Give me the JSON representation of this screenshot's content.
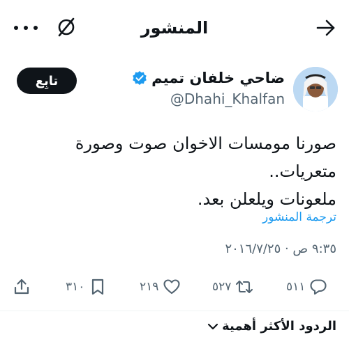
{
  "header": {
    "title": "المنشور",
    "more_icon": "more-horizontal-icon",
    "grok_icon": "grok-icon",
    "back_icon": "arrow-right-icon"
  },
  "author": {
    "name": "ضاحي خلفان تميم",
    "handle": "@Dhahi_Khalfan",
    "verified": true,
    "follow_label": "تابِع"
  },
  "tweet": {
    "line1": "صورنا مومسات الاخوان صوت وصورة متعريات..",
    "line2": "ملعونات ويلعلن بعد.",
    "translate_label": "ترجمة المنشور",
    "timestamp": "٩:٣٥ ص · ٢٠١٦/٧/٢٥"
  },
  "actions": {
    "reply_count": "٥١١",
    "retweet_count": "٥٢٧",
    "like_count": "٢١٩",
    "bookmark_count": "٣١٠"
  },
  "replies": {
    "sort_label": "الردود الأكثر أهمية"
  },
  "colors": {
    "accent": "#1d9bf0",
    "text": "#0f1419",
    "muted": "#536471"
  }
}
